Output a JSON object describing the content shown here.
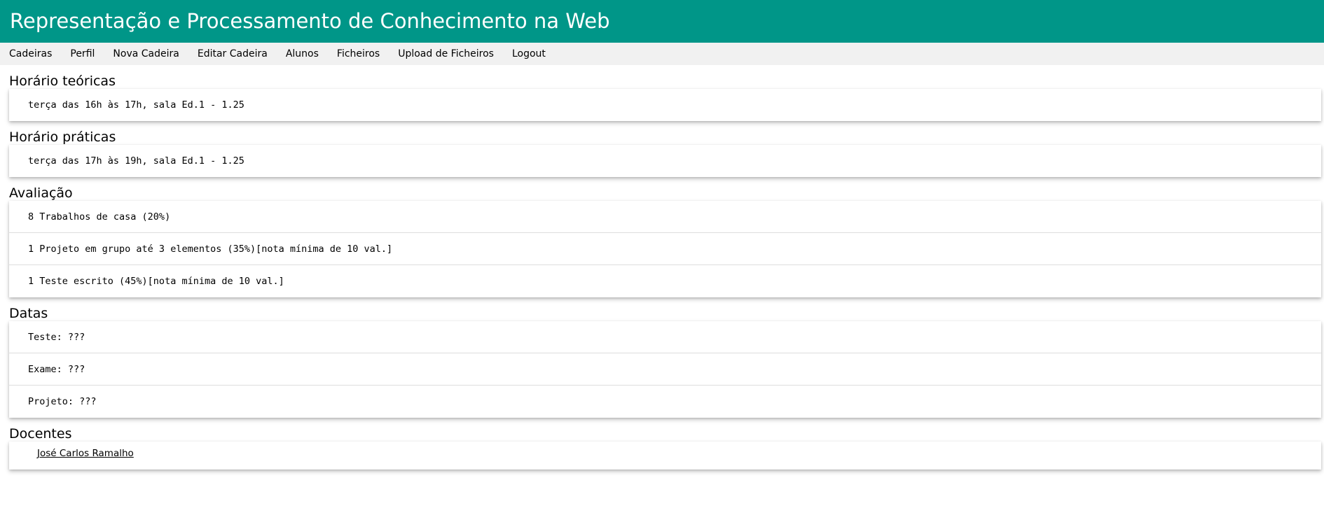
{
  "header": {
    "title": "Representação e Processamento de Conhecimento na Web",
    "background_color": "#009688"
  },
  "nav": {
    "items": [
      {
        "label": "Cadeiras"
      },
      {
        "label": "Perfil"
      },
      {
        "label": "Nova Cadeira"
      },
      {
        "label": "Editar Cadeira"
      },
      {
        "label": "Alunos"
      },
      {
        "label": "Ficheiros"
      },
      {
        "label": "Upload de Ficheiros"
      },
      {
        "label": "Logout"
      }
    ]
  },
  "sections": {
    "teoricas": {
      "title": "Horário teóricas",
      "items": [
        "terça das 16h às 17h, sala Ed.1 - 1.25"
      ]
    },
    "praticas": {
      "title": "Horário práticas",
      "items": [
        "terça das 17h às 19h, sala Ed.1 - 1.25"
      ]
    },
    "avaliacao": {
      "title": "Avaliação",
      "items": [
        "8 Trabalhos de casa (20%)",
        "1 Projeto em grupo até 3 elementos (35%)[nota mínima de 10 val.]",
        "1 Teste escrito (45%)[nota mínima de 10 val.]"
      ]
    },
    "datas": {
      "title": "Datas",
      "items": [
        "Teste: ???",
        "Exame: ???",
        "Projeto: ???"
      ]
    },
    "docentes": {
      "title": "Docentes",
      "items": [
        "José Carlos Ramalho"
      ]
    }
  }
}
